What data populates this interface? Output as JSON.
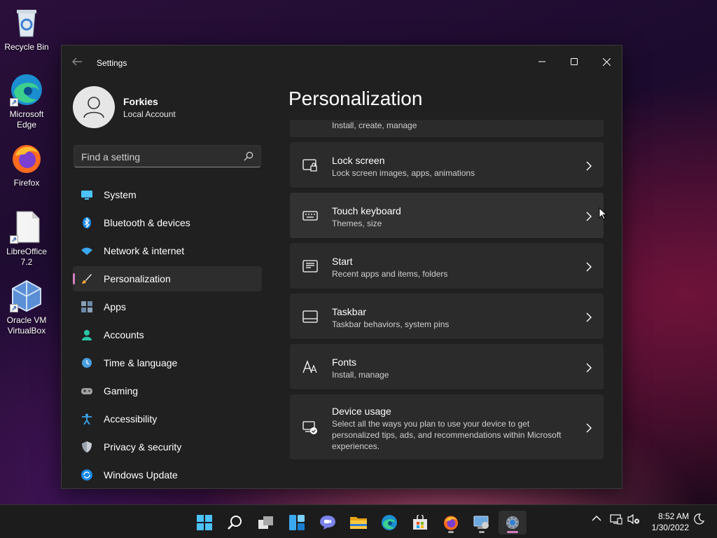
{
  "desktop": {
    "icons": [
      {
        "label": "Recycle Bin",
        "icon": "recycle-bin-icon"
      },
      {
        "label": "Microsoft Edge",
        "icon": "edge-icon"
      },
      {
        "label": "Firefox",
        "icon": "firefox-icon"
      },
      {
        "label": "LibreOffice 7.2",
        "icon": "libreoffice-icon"
      },
      {
        "label": "Oracle VM VirtualBox",
        "icon": "virtualbox-icon"
      }
    ]
  },
  "window": {
    "title": "Settings",
    "profile": {
      "name": "Forkies",
      "account_type": "Local Account"
    },
    "search": {
      "placeholder": "Find a setting"
    },
    "nav": [
      {
        "label": "System",
        "icon": "monitor-icon"
      },
      {
        "label": "Bluetooth & devices",
        "icon": "bluetooth-icon"
      },
      {
        "label": "Network & internet",
        "icon": "wifi-icon"
      },
      {
        "label": "Personalization",
        "icon": "brush-icon",
        "selected": true
      },
      {
        "label": "Apps",
        "icon": "apps-icon"
      },
      {
        "label": "Accounts",
        "icon": "person-icon"
      },
      {
        "label": "Time & language",
        "icon": "globe-clock-icon"
      },
      {
        "label": "Gaming",
        "icon": "gamepad-icon"
      },
      {
        "label": "Accessibility",
        "icon": "accessibility-icon"
      },
      {
        "label": "Privacy & security",
        "icon": "shield-icon"
      },
      {
        "label": "Windows Update",
        "icon": "update-icon"
      }
    ],
    "page_title": "Personalization",
    "cards": [
      {
        "title": "",
        "subtitle": "Install, create, manage",
        "icon": "partial-icon"
      },
      {
        "title": "Lock screen",
        "subtitle": "Lock screen images, apps, animations",
        "icon": "lock-screen-icon"
      },
      {
        "title": "Touch keyboard",
        "subtitle": "Themes, size",
        "icon": "keyboard-icon"
      },
      {
        "title": "Start",
        "subtitle": "Recent apps and items, folders",
        "icon": "start-menu-icon"
      },
      {
        "title": "Taskbar",
        "subtitle": "Taskbar behaviors, system pins",
        "icon": "taskbar-icon"
      },
      {
        "title": "Fonts",
        "subtitle": "Install, manage",
        "icon": "fonts-icon"
      },
      {
        "title": "Device usage",
        "subtitle": "Select all the ways you plan to use your device to get personalized tips, ads, and recommendations within Microsoft experiences.",
        "icon": "device-usage-icon"
      }
    ]
  },
  "taskbar": {
    "apps": [
      "start-icon",
      "search-icon",
      "task-view-icon",
      "widgets-icon",
      "chat-icon",
      "file-explorer-icon",
      "edge-icon",
      "store-icon",
      "firefox-icon",
      "control-panel-icon",
      "settings-icon"
    ],
    "tray": [
      "chevron-up-icon",
      "network-icon",
      "volume-muted-icon"
    ],
    "time": "8:52 AM",
    "date": "1/30/2022"
  },
  "colors": {
    "accent": "#d47fbf",
    "window_bg": "#202020",
    "card_bg": "#2b2b2b"
  }
}
